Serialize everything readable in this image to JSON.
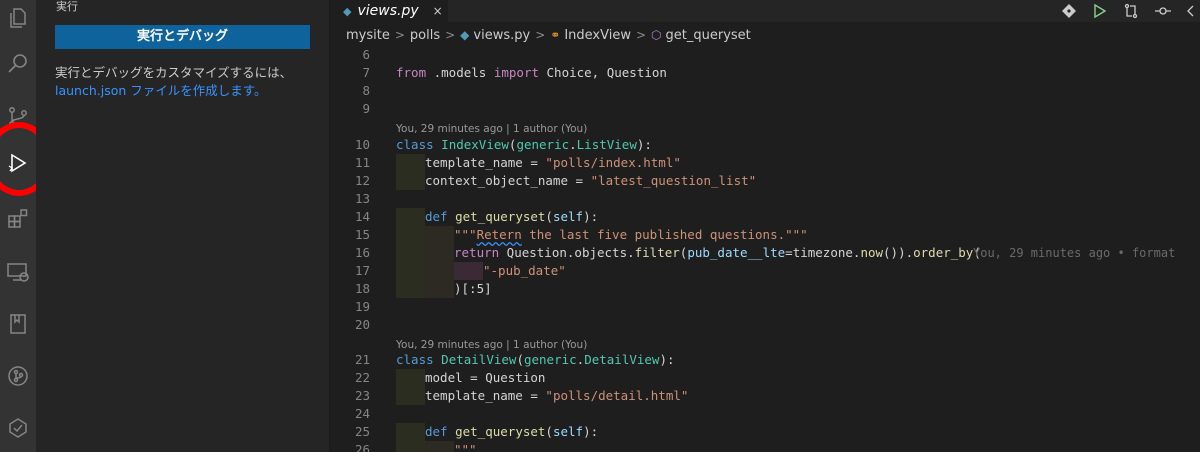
{
  "activity_bar": {
    "icons": [
      "files-icon",
      "search-icon",
      "source-control-icon",
      "run-debug-icon",
      "extensions-icon",
      "remote-explorer-icon",
      "bookmarks-icon",
      "git-graph-icon",
      "testing-icon"
    ]
  },
  "sidebar": {
    "title": "実行",
    "run_button_label": "実行とデバッグ",
    "description": "実行とデバッグをカスタマイズするには、",
    "link_text": "launch.json ファイルを作成します。"
  },
  "tab": {
    "file_name": "views.py",
    "close_symbol": "×"
  },
  "breadcrumb": {
    "items": [
      "mysite",
      "polls",
      "views.py",
      "IndexView",
      "get_queryset"
    ]
  },
  "blame": {
    "class_index": "You, 29 minutes ago | 1 author (You)",
    "class_detail": "You, 29 minutes ago | 1 author (You)",
    "inline": "You, 29 minutes ago • format"
  },
  "code": {
    "l6": {
      "num": "6"
    },
    "l7": {
      "num": "7",
      "kw_from": "from",
      "mod": " .models ",
      "kw_import": "import",
      "rest": " Choice, Question"
    },
    "l8": {
      "num": "8"
    },
    "l9": {
      "num": "9"
    },
    "l10": {
      "num": "10",
      "kw": "class",
      "name": "IndexView",
      "p1": "(",
      "base1": "generic",
      "dot": ".",
      "base2": "ListView",
      "p2": "):"
    },
    "l11": {
      "num": "11",
      "var": "template_name",
      "eq": " = ",
      "str": "\"polls/index.html\""
    },
    "l12": {
      "num": "12",
      "var": "context_object_name",
      "eq": " = ",
      "str": "\"latest_question_list\""
    },
    "l13": {
      "num": "13"
    },
    "l14": {
      "num": "14",
      "kw": "def",
      "fn": "get_queryset",
      "p1": "(",
      "self": "self",
      "p2": "):"
    },
    "l15": {
      "num": "15",
      "q1": "\"\"\"",
      "word": "Retern",
      "rest": " the last five published questions.\"\"\""
    },
    "l16": {
      "num": "16",
      "kw": "return",
      "a": " Question",
      "b": ".objects.",
      "c": "filter",
      "d": "(",
      "e": "pub_date__lte",
      "f": "=",
      "g": "timezone",
      "h": ".",
      "i": "now",
      "j": "()).",
      "k": "order_by",
      "l": "("
    },
    "l17": {
      "num": "17",
      "str": "\"-pub_date\""
    },
    "l18": {
      "num": "18",
      "text": ")[:5]"
    },
    "l19": {
      "num": "19"
    },
    "l20": {
      "num": "20"
    },
    "l21": {
      "num": "21",
      "kw": "class",
      "name": "DetailView",
      "p1": "(",
      "base1": "generic",
      "dot": ".",
      "base2": "DetailView",
      "p2": "):"
    },
    "l22": {
      "num": "22",
      "var": "model",
      "eq": " = ",
      "val": "Question"
    },
    "l23": {
      "num": "23",
      "var": "template_name",
      "eq": " = ",
      "str": "\"polls/detail.html\""
    },
    "l24": {
      "num": "24"
    },
    "l25": {
      "num": "25",
      "kw": "def",
      "fn": "get_queryset",
      "p1": "(",
      "self": "self",
      "p2": "):"
    },
    "l26": {
      "num": "26",
      "str": "\"\"\""
    }
  }
}
